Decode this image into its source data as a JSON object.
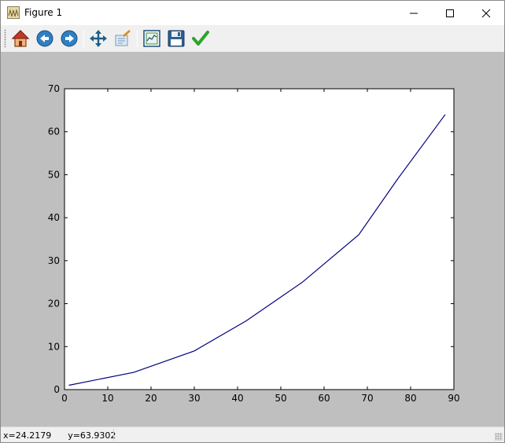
{
  "window": {
    "title": "Figure 1"
  },
  "toolbar": {
    "buttons": [
      {
        "name": "home",
        "icon": "home-icon"
      },
      {
        "name": "back",
        "icon": "back-arrow-icon"
      },
      {
        "name": "forward",
        "icon": "forward-arrow-icon"
      },
      {
        "name": "pan",
        "icon": "move-icon"
      },
      {
        "name": "zoom",
        "icon": "zoom-rect-icon"
      },
      {
        "name": "subplots",
        "icon": "subplots-icon"
      },
      {
        "name": "save",
        "icon": "floppy-disk-icon"
      },
      {
        "name": "edit",
        "icon": "checkmark-icon"
      }
    ]
  },
  "status": {
    "coords": "x=24.2179      y=63.9302"
  },
  "colors": {
    "line": "#000080",
    "canvas_bg": "#bfbfbf",
    "axes_bg": "#ffffff"
  },
  "chart_data": {
    "type": "line",
    "title": "",
    "xlabel": "",
    "ylabel": "",
    "xlim": [
      0,
      90
    ],
    "ylim": [
      0,
      70
    ],
    "xticks": [
      "0",
      "10",
      "20",
      "30",
      "40",
      "50",
      "60",
      "70",
      "80",
      "90"
    ],
    "yticks": [
      "0",
      "10",
      "20",
      "30",
      "40",
      "50",
      "60",
      "70"
    ],
    "grid": false,
    "series": [
      {
        "x": [
          1,
          16,
          30,
          42,
          55,
          68,
          77,
          88
        ],
        "y": [
          1,
          4,
          9,
          16,
          25,
          36,
          49,
          64
        ]
      }
    ]
  }
}
